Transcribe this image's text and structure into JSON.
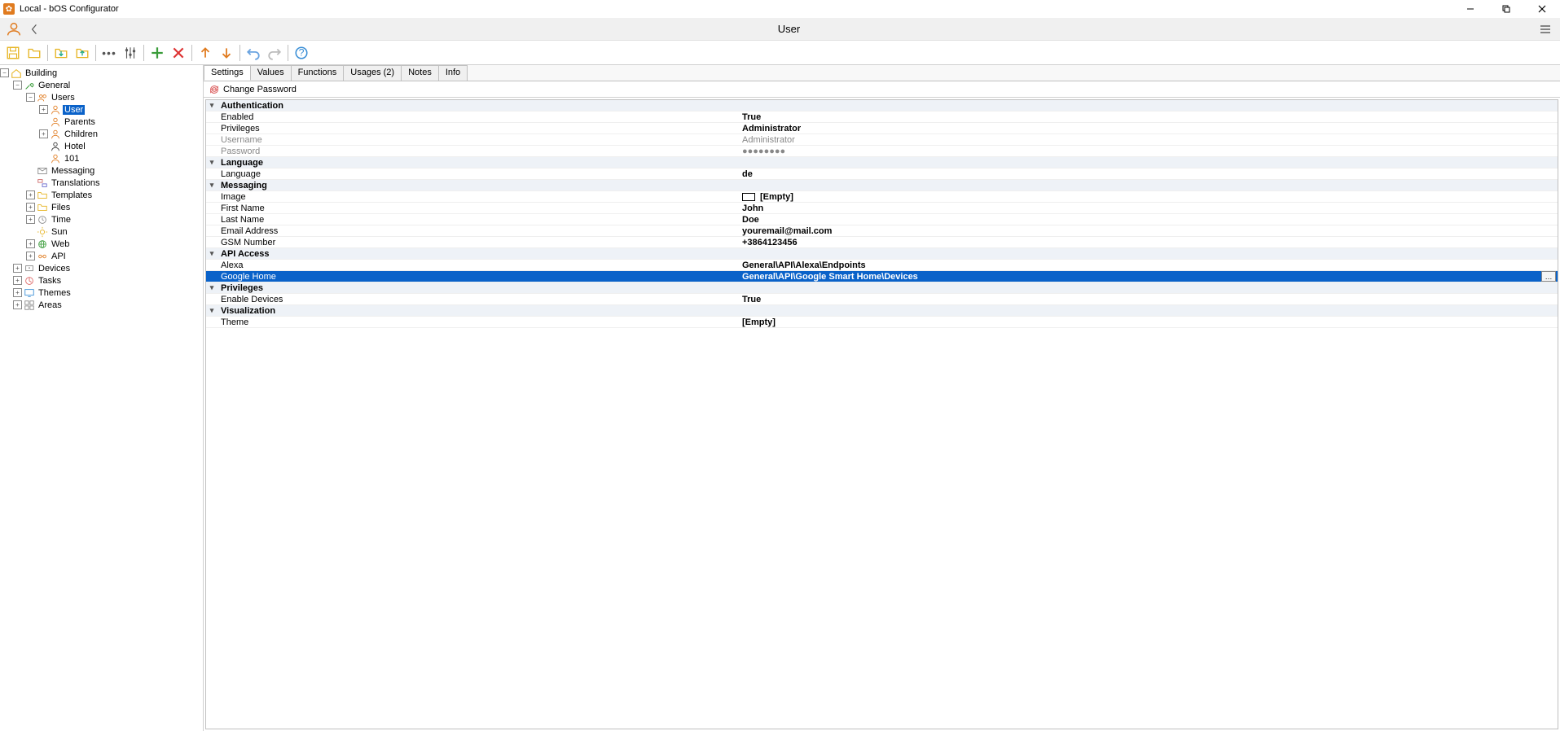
{
  "window": {
    "title": "Local - bOS Configurator"
  },
  "header": {
    "page_title": "User"
  },
  "tabs": [
    "Settings",
    "Values",
    "Functions",
    "Usages (2)",
    "Notes",
    "Info"
  ],
  "action": {
    "change_password": "Change Password"
  },
  "tree": {
    "root": "Building",
    "general": "General",
    "users": "Users",
    "user": "User",
    "parents": "Parents",
    "children": "Children",
    "hotel": "Hotel",
    "n101": "101",
    "messaging": "Messaging",
    "translations": "Translations",
    "templates": "Templates",
    "files": "Files",
    "time": "Time",
    "sun": "Sun",
    "web": "Web",
    "api": "API",
    "devices": "Devices",
    "tasks": "Tasks",
    "themes": "Themes",
    "areas": "Areas"
  },
  "props": {
    "auth": {
      "header": "Authentication",
      "enabled_l": "Enabled",
      "enabled_v": "True",
      "priv_l": "Privileges",
      "priv_v": "Administrator",
      "user_l": "Username",
      "user_v": "Administrator",
      "pass_l": "Password",
      "pass_v": "●●●●●●●●"
    },
    "lang": {
      "header": "Language",
      "lang_l": "Language",
      "lang_v": "de"
    },
    "msg": {
      "header": "Messaging",
      "img_l": "Image",
      "img_v": "[Empty]",
      "fn_l": "First Name",
      "fn_v": "John",
      "ln_l": "Last Name",
      "ln_v": "Doe",
      "em_l": "Email Address",
      "em_v": "youremail@mail.com",
      "gsm_l": "GSM Number",
      "gsm_v": "+3864123456"
    },
    "api": {
      "header": "API Access",
      "alexa_l": "Alexa",
      "alexa_v": "General\\API\\Alexa\\Endpoints",
      "gh_l": "Google Home",
      "gh_v": "General\\API\\Google Smart Home\\Devices"
    },
    "privs": {
      "header": "Privileges",
      "ed_l": "Enable Devices",
      "ed_v": "True"
    },
    "vis": {
      "header": "Visualization",
      "th_l": "Theme",
      "th_v": "[Empty]"
    }
  }
}
